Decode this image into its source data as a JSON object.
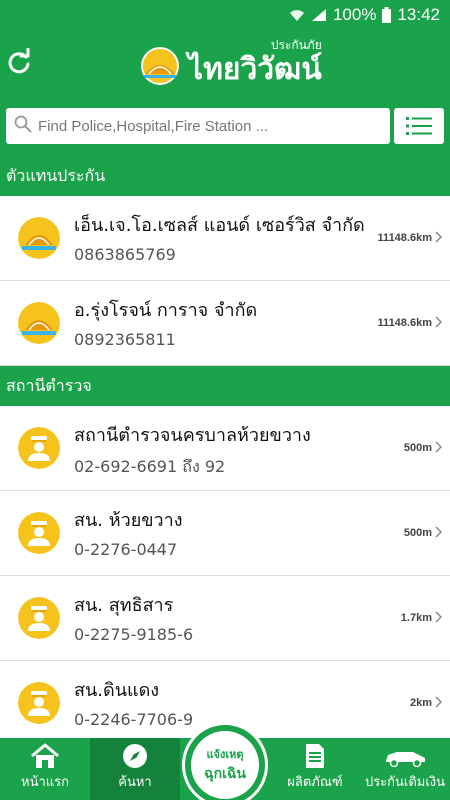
{
  "status_bar": {
    "battery": "100%",
    "time": "13:42"
  },
  "header": {
    "brand_small": "ประกันภัย",
    "brand_name": "ไทยวิวัฒน์"
  },
  "search": {
    "placeholder": "Find Police,Hospital,Fire Station ..."
  },
  "sections": [
    {
      "title": "ตัวแทนประกัน",
      "items": [
        {
          "name": "เอ็น.เจ.โอ.เซลส์ แอนด์ เซอร์วิส จำกัด",
          "phone": "0863865769",
          "distance": "11148.6km",
          "icon": "insurance-logo-icon"
        },
        {
          "name": "อ.รุ่งโรจน์ การาจ จำกัด",
          "phone": "0892365811",
          "distance": "11148.6km",
          "icon": "insurance-logo-icon"
        }
      ]
    },
    {
      "title": "สถานีตำรวจ",
      "items": [
        {
          "name": "สถานีตำรวจนครบาลห้วยขวาง",
          "phone": "02-692-6691 ถึง 92",
          "distance": "500m",
          "icon": "police-officer-icon"
        },
        {
          "name": "สน. ห้วยขวาง",
          "phone": "0-2276-0447",
          "distance": "500m",
          "icon": "police-officer-icon"
        },
        {
          "name": "สน. สุทธิสาร",
          "phone": "0-2275-9185-6",
          "distance": "1.7km",
          "icon": "police-officer-icon"
        },
        {
          "name": "สน.ดินแดง",
          "phone": "0-2246-7706-9",
          "distance": "2km",
          "icon": "police-officer-icon"
        }
      ]
    }
  ],
  "bottom_nav": {
    "home": "หน้าแรก",
    "search": "ค้นหา",
    "emergency_line1": "แจ้งเหตุ",
    "emergency_line2": "ฉุกเฉิน",
    "products": "ผลิตภัณฑ์",
    "refund": "ประกันเติมเงิน"
  },
  "colors": {
    "primary": "#1aa34a",
    "active_tab": "#14823a",
    "avatar_yellow": "#f6c21c"
  }
}
